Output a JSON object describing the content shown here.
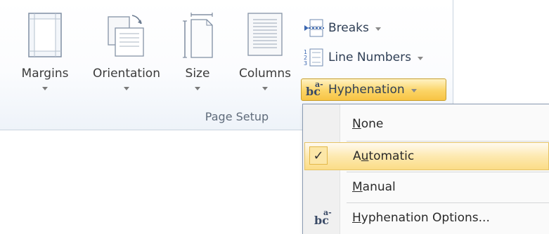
{
  "ribbon": {
    "group_label": "Page Setup",
    "buttons": {
      "margins": {
        "label": "Margins",
        "icon": "margins-icon"
      },
      "orientation": {
        "label": "Orientation",
        "icon": "orientation-icon"
      },
      "size": {
        "label": "Size",
        "icon": "page-size-icon"
      },
      "columns": {
        "label": "Columns",
        "icon": "columns-icon"
      }
    },
    "small_buttons": {
      "breaks": {
        "label": "Breaks",
        "icon": "breaks-icon"
      },
      "line_numbers": {
        "label": "Line Numbers",
        "icon": "line-numbers-icon"
      },
      "hyphenation": {
        "label": "Hyphenation",
        "icon": "hyphenation-icon",
        "icon_text": "bc",
        "icon_sup": "a-"
      }
    }
  },
  "menu": {
    "items": [
      {
        "pre": "",
        "ul": "N",
        "post": "one",
        "checked": false
      },
      {
        "pre": "A",
        "ul": "u",
        "post": "tomatic",
        "checked": true,
        "check_glyph": "✓"
      },
      {
        "pre": "",
        "ul": "M",
        "post": "anual",
        "checked": false
      },
      {
        "pre": "",
        "ul": "H",
        "post": "yphenation Options...",
        "checked": false,
        "icon": "hyphenation-icon",
        "icon_text": "bc",
        "icon_sup": "a-"
      }
    ]
  },
  "colors": {
    "active_yellow": "#fbd466",
    "ribbon_border": "#c9d3df",
    "text_blue": "#2f3f55"
  }
}
